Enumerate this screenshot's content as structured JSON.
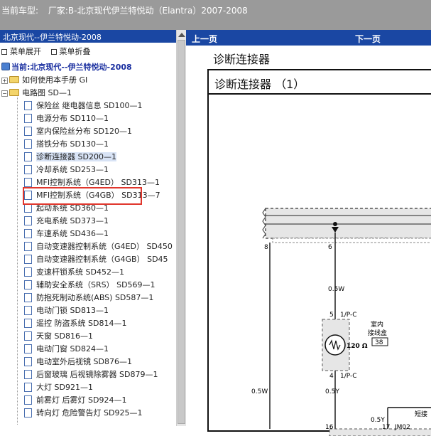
{
  "titlebar": {
    "label": "当前车型:",
    "value": "厂家:B-北京现代伊兰特悦动（Elantra）2007-2008"
  },
  "sidebar": {
    "header": "北京现代--伊兰特悦动-2008",
    "expand": "菜单展开",
    "collapse": "菜单折叠",
    "root": "当前:北京现代--伊兰特悦动-2008",
    "folders": [
      {
        "label": "如何使用本手册 GI"
      },
      {
        "label": "电路图 SD—1"
      }
    ],
    "items": [
      {
        "label": "保险丝 继电器信息 SD100—1"
      },
      {
        "label": "电源分布 SD110—1"
      },
      {
        "label": "室内保险丝分布 SD120—1"
      },
      {
        "label": "搭铁分布 SD130—1"
      },
      {
        "label": "诊断连接器 SD200—1"
      },
      {
        "label": "冷却系统 SD253—1"
      },
      {
        "label": "MFI控制系统（G4ED） SD313—1"
      },
      {
        "label": "MFI控制系统（G4GB） SD313—7"
      },
      {
        "label": "起动系统 SD360—1"
      },
      {
        "label": "充电系统 SD373—1"
      },
      {
        "label": "车速系统 SD436—1"
      },
      {
        "label": "自动变速器控制系统（G4ED） SD450"
      },
      {
        "label": "自动变速器控制系统（G4GB） SD45"
      },
      {
        "label": "变速杆锁系统 SD452—1"
      },
      {
        "label": "辅助安全系统（SRS） SD569—1"
      },
      {
        "label": "防抱死制动系统(ABS) SD587—1"
      },
      {
        "label": "电动门锁 SD813—1"
      },
      {
        "label": "遥控 防盗系统 SD814—1"
      },
      {
        "label": "天窗 SD816—1"
      },
      {
        "label": "电动门窗 SD824—1"
      },
      {
        "label": "电动室外后视镜 SD876—1"
      },
      {
        "label": "后窗玻璃 后视镜除雾器 SD879—1"
      },
      {
        "label": "大灯 SD921—1"
      },
      {
        "label": "前雾灯 后雾灯 SD924—1"
      },
      {
        "label": "转向灯 危险警告灯 SD925—1"
      }
    ]
  },
  "main": {
    "prev": "上一页",
    "next": "下一页",
    "doc_title": "诊断连接器",
    "frame_title": "诊断连接器 （1）"
  },
  "diagram": {
    "pins": {
      "p8": "8",
      "p6": "6",
      "p5": "5",
      "p4": "4",
      "p16": "16",
      "p17": "17"
    },
    "wires": {
      "w1": "0.5W",
      "w2": "0.5W",
      "w3": "0.5Y",
      "w4": "0.5Y"
    },
    "conn1": "1/P-C",
    "conn2": "1/P-C",
    "box_label1": "室内",
    "box_label2": "接线盒",
    "box_ref": "38",
    "resistor": "120 Ω",
    "jm": "JM02",
    "short": "短接"
  }
}
